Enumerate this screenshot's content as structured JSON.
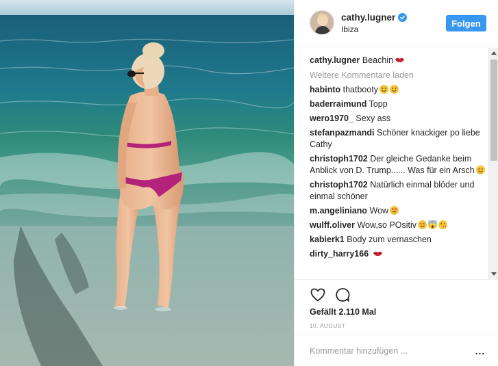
{
  "post": {
    "username": "cathy.lugner",
    "verified": true,
    "location": "Ibiza",
    "follow_label": "Folgen",
    "photo_icon": "beach-photo"
  },
  "caption": {
    "user": "cathy.lugner",
    "text": " Beachin",
    "emoji": "lips"
  },
  "load_more_label": "Weitere Kommentare laden",
  "comments": [
    {
      "user": "habinto",
      "text": " thatbooty",
      "emojis": [
        "smile",
        "smile"
      ]
    },
    {
      "user": "baderraimund",
      "text": " Topp",
      "emojis": []
    },
    {
      "user": "wero1970_",
      "text": " Sexy ass",
      "emojis": []
    },
    {
      "user": "stefanpazmandi",
      "text": " Schöner knackiger po liebe Cathy",
      "emojis": []
    },
    {
      "user": "christoph1702",
      "text": " Der gleiche Gedanke beim Anblick von D. Trump...... Was für ein Arsch",
      "emojis": [
        "smile"
      ]
    },
    {
      "user": "christoph1702",
      "text": " Natürlich einmal blöder und einmal schöner",
      "emojis": []
    },
    {
      "user": "m.angeliniano",
      "text": " Wow",
      "emojis": [
        "heart-eyes"
      ]
    },
    {
      "user": "wulff.oliver",
      "text": " Wow,so POsitiv",
      "emojis": [
        "smile",
        "scream",
        "kiss"
      ]
    },
    {
      "user": "kabierk1",
      "text": " Body zum vernaschen",
      "emojis": []
    },
    {
      "user": "dirty_harry166",
      "text": " ",
      "emojis": [
        "lips"
      ]
    }
  ],
  "likes_label": "Gefällt 2.110 Mal",
  "date_label": "10. AUGUST",
  "add_comment_placeholder": "Kommentar hinzufügen ...",
  "more_options_label": "...",
  "colors": {
    "accent": "#3897f0",
    "text": "#262626",
    "muted": "#999999",
    "border": "#efefef"
  }
}
